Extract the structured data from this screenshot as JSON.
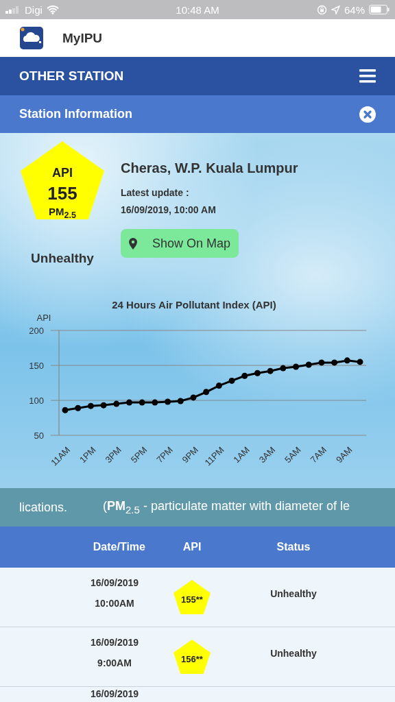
{
  "status_bar": {
    "carrier": "Digi",
    "time": "10:48 AM",
    "battery": "64%"
  },
  "app_header": {
    "title": "MyIPU"
  },
  "nav_bar": {
    "title": "OTHER STATION"
  },
  "panel": {
    "title": "Station Information"
  },
  "station": {
    "api_label": "API",
    "api_value": "155",
    "pollutant": "PM$_{2.5}$",
    "status": "Unhealthy",
    "name": "Cheras, W.P. Kuala Lumpur",
    "update_label": "Latest update :",
    "update_time": "16/09/2019, 10:00 AM",
    "map_button": "Show On Map"
  },
  "chart_data": {
    "type": "line",
    "title": "24 Hours Air Pollutant Index (API)",
    "ylabel": "API",
    "categories": [
      "11AM",
      null,
      "1PM",
      null,
      "3PM",
      null,
      "5PM",
      null,
      "7PM",
      null,
      "9PM",
      null,
      "11PM",
      null,
      "1AM",
      null,
      "3AM",
      null,
      "5AM",
      null,
      "7AM",
      null,
      "9AM",
      null
    ],
    "series": [
      {
        "color": "#000000",
        "marker": true,
        "values": [
          86,
          89,
          92,
          93,
          95,
          97,
          97,
          97,
          98,
          99,
          104,
          112,
          121,
          128,
          135,
          139,
          142,
          146,
          148,
          151,
          154,
          154,
          157,
          155
        ]
      }
    ],
    "ylim": [
      50,
      200
    ],
    "yticks": [
      50,
      100,
      150,
      200
    ]
  },
  "ticker": [
    "lications.",
    "(**PM**$_{2.5}$ - particulate matter with diameter of le"
  ],
  "table": {
    "columns": [
      "Date/Time",
      "API",
      "Status"
    ],
    "rows": [
      {
        "date": "16/09/2019",
        "time": "10:00AM",
        "api": "155**",
        "status": "Unhealthy"
      },
      {
        "date": "16/09/2019",
        "time": "9:00AM",
        "api": "156**",
        "status": "Unhealthy"
      },
      {
        "date": "16/09/2019"
      }
    ]
  }
}
